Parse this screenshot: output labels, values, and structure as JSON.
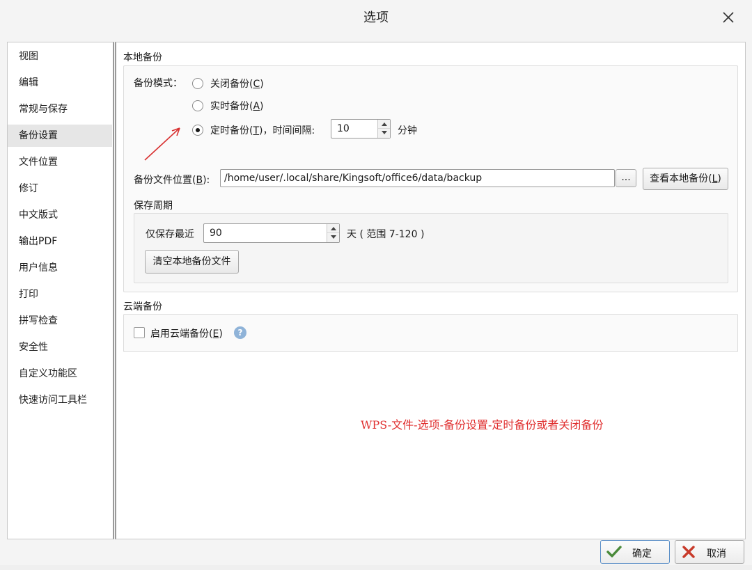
{
  "dialog": {
    "title": "选项"
  },
  "sidebar": {
    "items": [
      {
        "label": "视图"
      },
      {
        "label": "编辑"
      },
      {
        "label": "常规与保存"
      },
      {
        "label": "备份设置"
      },
      {
        "label": "文件位置"
      },
      {
        "label": "修订"
      },
      {
        "label": "中文版式"
      },
      {
        "label": "输出PDF"
      },
      {
        "label": "用户信息"
      },
      {
        "label": "打印"
      },
      {
        "label": "拼写检查"
      },
      {
        "label": "安全性"
      },
      {
        "label": "自定义功能区"
      },
      {
        "label": "快速访问工具栏"
      }
    ],
    "active": "备份设置"
  },
  "local_backup": {
    "title": "本地备份",
    "mode_label": "备份模式：",
    "modes": {
      "off": {
        "text": "关闭备份(",
        "key": "C",
        "end": ")"
      },
      "realtime": {
        "text": "实时备份(",
        "key": "A",
        "end": ")"
      },
      "timed": {
        "text": "定时备份(",
        "key": "T",
        "end": ")，时间间隔:"
      }
    },
    "selected_mode": "timed",
    "interval_value": "10",
    "interval_unit": "分钟",
    "location_label_pre": "备份文件位置(",
    "location_label_key": "B",
    "location_label_post": "):",
    "location_path": "/home/user/.local/share/Kingsoft/office6/data/backup",
    "browse_label": "...",
    "view_label_pre": "查看本地备份(",
    "view_label_key": "L",
    "view_label_post": ")",
    "period": {
      "title": "保存周期",
      "keep_label": "仅保存最近",
      "days_value": "90",
      "range_text": "天 ( 范围 7-120 )",
      "clear_label": "清空本地备份文件"
    }
  },
  "cloud_backup": {
    "title": "云端备份",
    "enable_pre": "启用云端备份(",
    "enable_key": "E",
    "enable_post": ")",
    "enabled": false,
    "help_glyph": "?"
  },
  "annotation": "WPS-文件-选项-备份设置-定时备份或者关闭备份",
  "footer": {
    "ok_label": "确定",
    "cancel_label": "取消"
  },
  "colors": {
    "annotation": "#e03030",
    "arrow": "#d83030",
    "ok_icon": "#4a8a3a",
    "cancel_icon": "#c83a2a"
  }
}
